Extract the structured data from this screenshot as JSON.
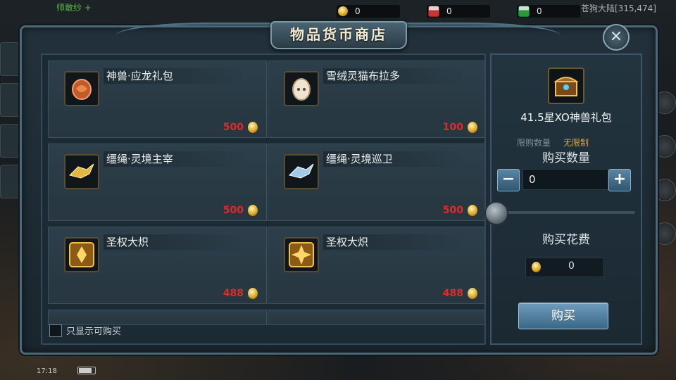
{
  "hud": {
    "gold_count": "0",
    "gift_red_count": "0",
    "gift_green_count": "0",
    "region": "苍狗大陆[315,474]",
    "left_text": "师敢纱 +",
    "status_time": "17:18"
  },
  "shop": {
    "title": "物品货币商店",
    "close_icon": "×",
    "items": [
      {
        "name": "神兽·应龙礼包",
        "price": "500",
        "icon": "dragon-gift-icon"
      },
      {
        "name": "雪绒灵猫布拉多",
        "price": "100",
        "icon": "cat-egg-icon"
      },
      {
        "name": "缰绳·灵境主宰",
        "price": "500",
        "icon": "rein-golden-icon"
      },
      {
        "name": "缰绳·灵境巡卫",
        "price": "500",
        "icon": "rein-silver-icon"
      },
      {
        "name": "圣权大炽",
        "price": "488",
        "icon": "emblem-icon"
      },
      {
        "name": "圣权大炽",
        "price": "488",
        "icon": "emblem-icon"
      }
    ],
    "filter_label": "只显示可购买"
  },
  "detail": {
    "selected_name": "41.5星XO神兽礼包",
    "limit_label": "限购数量",
    "limit_value": "无限制",
    "qty_label": "购买数量",
    "qty_value": "0",
    "minus": "−",
    "plus": "+",
    "cost_label": "购买花费",
    "cost_value": "0",
    "buy_label": "购买"
  },
  "colors": {
    "price_red": "#e02a2a",
    "limit_gold": "#d9a63a",
    "button_blue": "#4f7f9f"
  }
}
